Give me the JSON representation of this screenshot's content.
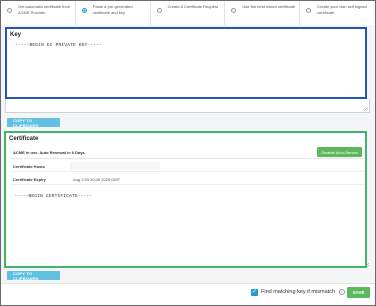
{
  "options": [
    {
      "label": "Get automatic certificate from ACME Provider",
      "selected": false
    },
    {
      "label": "Paste a pre-generated certificate and key",
      "selected": true
    },
    {
      "label": "Create A Certificate Request",
      "selected": false
    },
    {
      "label": "Use the best match certificate",
      "selected": false
    },
    {
      "label": "Create your own self signed certificate",
      "selected": false
    }
  ],
  "key_section": {
    "title": "Key",
    "content": "-----BEGIN EC PRIVATE KEY-----",
    "copy_button": "COPY TO CLIPBOARD"
  },
  "certificate_section": {
    "title": "Certificate",
    "status_text": "ACME in use. Auto Renewal in 6 Days.",
    "disable_button": "Disable Auto-Renew",
    "hosts_label": "Certificate Hosts",
    "hosts_value": "",
    "expiry_label": "Certificate Expiry",
    "expiry_value": "Aug 3 03:30:45 2025 GMT",
    "content": "-----BEGIN CERTIFICATE-----",
    "copy_button": "COPY TO CLIPBOARD"
  },
  "footer": {
    "checkbox_checked": true,
    "checkbox_label": "Find matching key if mismatch",
    "save_button": "SAVE"
  },
  "colors": {
    "key_border": "#2255b5",
    "certificate_border": "#3fb56a",
    "copy_button": "#62c1e3",
    "save_button": "#5cb85c"
  }
}
